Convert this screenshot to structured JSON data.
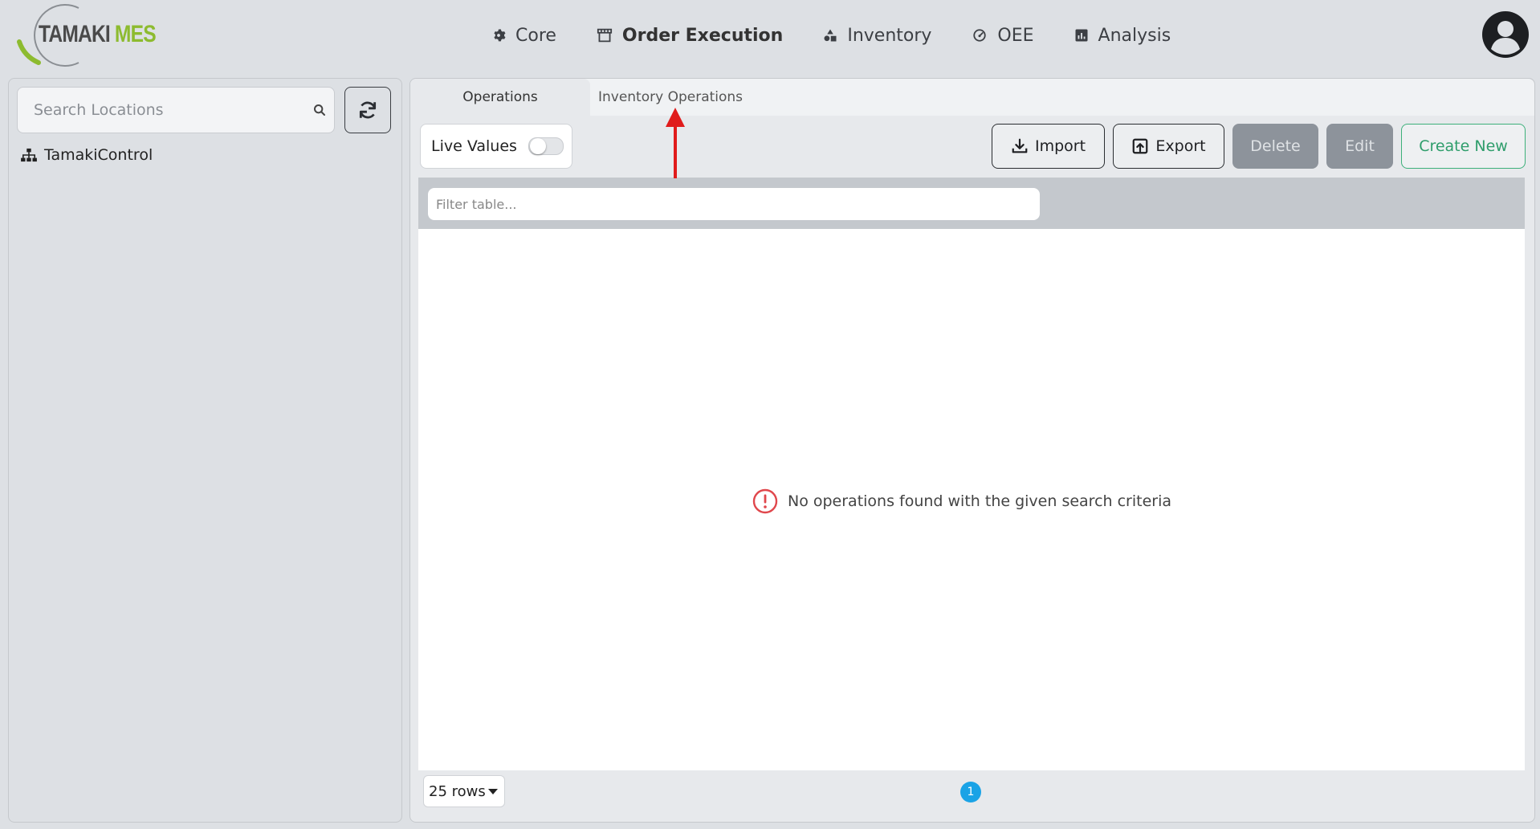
{
  "app": {
    "logo_part1": "TAMAKI",
    "logo_part2": "MES"
  },
  "nav": {
    "items": [
      {
        "label": "Core",
        "icon": "gear-icon"
      },
      {
        "label": "Order Execution",
        "icon": "store-icon",
        "active": true
      },
      {
        "label": "Inventory",
        "icon": "shapes-icon"
      },
      {
        "label": "OEE",
        "icon": "gauge-icon"
      },
      {
        "label": "Analysis",
        "icon": "chart-square-icon"
      }
    ],
    "user_icon": "user-avatar-icon"
  },
  "sidebar": {
    "search_placeholder": "Search Locations",
    "tree": [
      {
        "label": "TamakiControl",
        "icon": "sitemap-icon"
      }
    ]
  },
  "main": {
    "tabs": [
      {
        "label": "Operations",
        "active": true
      },
      {
        "label": "Inventory Operations",
        "active": false
      }
    ],
    "toolbar": {
      "live_values_label": "Live Values",
      "live_values_on": false,
      "import_label": "Import",
      "export_label": "Export",
      "delete_label": "Delete",
      "edit_label": "Edit",
      "create_label": "Create New"
    },
    "table": {
      "filter_placeholder": "Filter table...",
      "empty_message": "No operations found with the given search criteria",
      "rows_per_page": "25 rows",
      "current_page": "1"
    }
  },
  "colors": {
    "accent_green": "#2e9d6b",
    "logo_green": "#8dbb2f",
    "page_active": "#1aa3e6",
    "error_red": "#e0474c",
    "annotation_red": "#e01b1b"
  }
}
